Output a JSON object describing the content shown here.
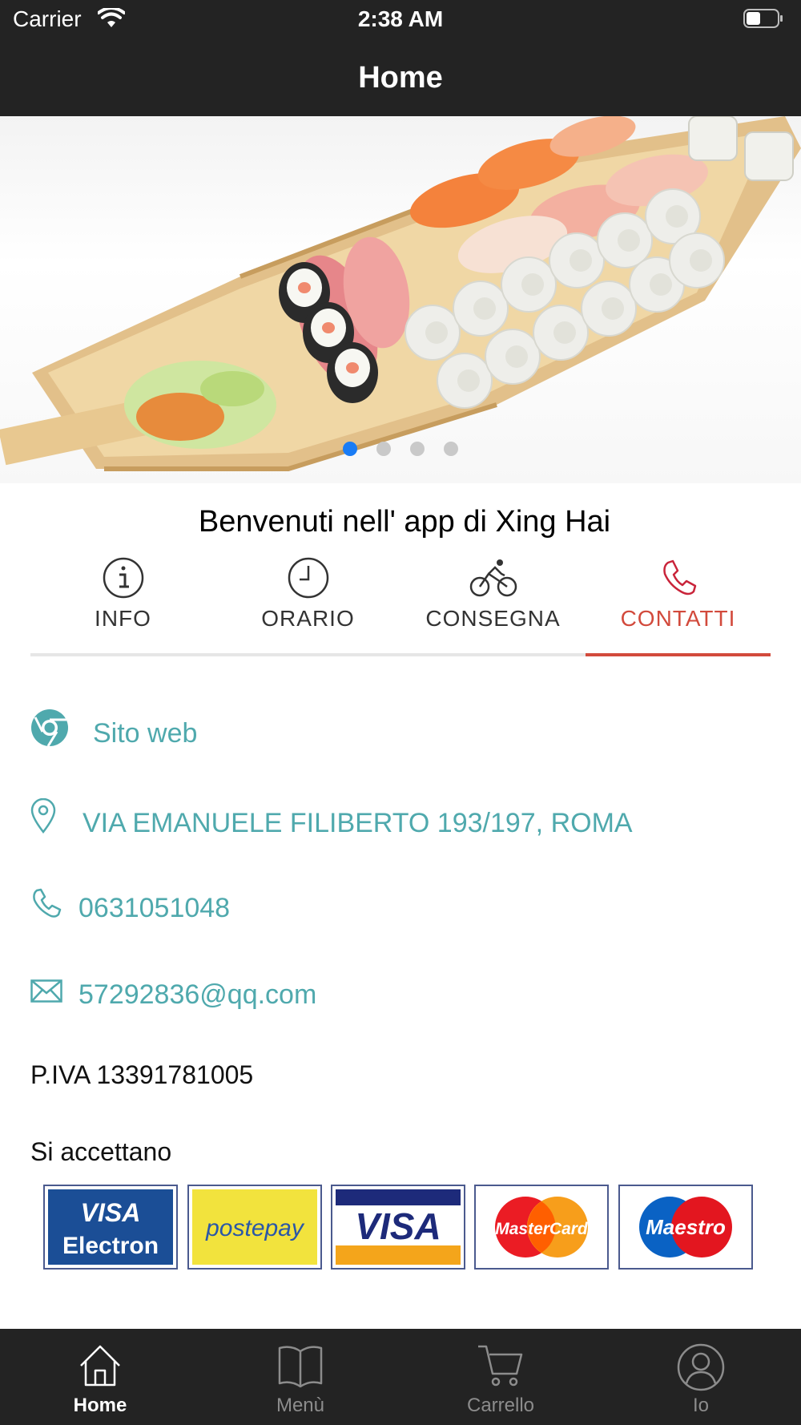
{
  "status_bar": {
    "carrier": "Carrier",
    "time": "2:38 AM"
  },
  "nav": {
    "title": "Home"
  },
  "hero": {
    "image": "sushi boat platter",
    "slide_count": 4,
    "active_slide": 1
  },
  "welcome": "Benvenuti nell' app di Xing Hai",
  "tabs": [
    {
      "label": "INFO",
      "icon": "info-icon"
    },
    {
      "label": "ORARIO",
      "icon": "clock-icon"
    },
    {
      "label": "CONSEGNA",
      "icon": "bicycle-icon"
    },
    {
      "label": "CONTATTI",
      "icon": "phone-icon"
    }
  ],
  "active_tab": "CONTATTI",
  "contacts": {
    "website": "Sito web",
    "address": "VIA EMANUELE FILIBERTO 193/197, ROMA",
    "phone": "0631051048",
    "email": "57292836@qq.com"
  },
  "vat": "P.IVA 13391781005",
  "accepted_label": "Si accettano",
  "payment_cards": [
    {
      "name": "visa-electron",
      "line1": "VISA",
      "line2": "Electron"
    },
    {
      "name": "postepay",
      "text": "postepay"
    },
    {
      "name": "visa",
      "text": "VISA"
    },
    {
      "name": "mastercard",
      "text": "MasterCard"
    },
    {
      "name": "maestro",
      "text": "Maestro"
    }
  ],
  "tab_bar": [
    {
      "label": "Home",
      "icon": "home-icon"
    },
    {
      "label": "Menù",
      "icon": "book-icon"
    },
    {
      "label": "Carrello",
      "icon": "cart-icon"
    },
    {
      "label": "Io",
      "icon": "user-icon"
    }
  ],
  "colors": {
    "bar": "#232323",
    "accent": "#d24a3c",
    "link": "#4fa9ad",
    "dot_active": "#1a7cf5"
  }
}
